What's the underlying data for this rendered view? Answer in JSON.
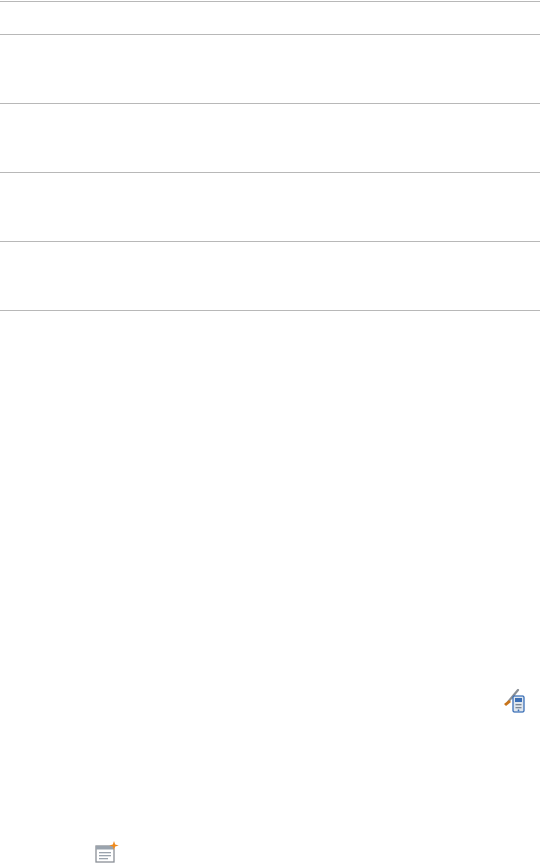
{
  "list": {
    "row_count": 4
  },
  "icons": {
    "style_editor": "paintbrush-tablet-icon",
    "new_window": "new-window-icon"
  },
  "colors": {
    "divider": "#b8b8b8",
    "icon_orange": "#f08a1c",
    "icon_blue": "#3b6fb6",
    "icon_gray": "#9aa3ad"
  }
}
